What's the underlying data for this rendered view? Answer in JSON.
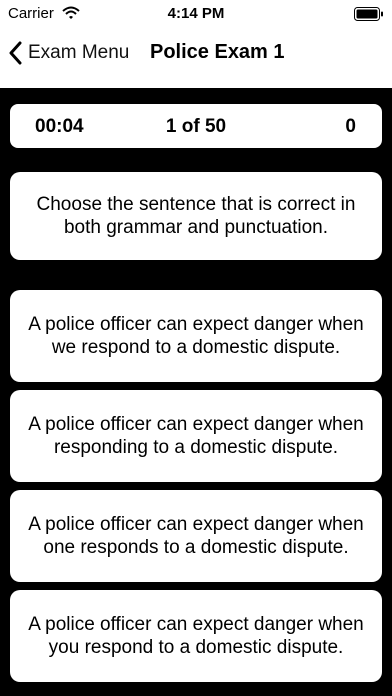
{
  "status_bar": {
    "carrier": "Carrier",
    "time": "4:14 PM",
    "wifi_icon": "wifi-icon",
    "battery_icon": "battery-icon"
  },
  "nav": {
    "back_label": "Exam Menu",
    "title": "Police Exam 1",
    "back_icon": "chevron-left-icon"
  },
  "stats": {
    "timer": "00:04",
    "progress": "1 of 50",
    "score": "0"
  },
  "question": {
    "text": "Choose the sentence that is correct in both grammar and punctuation."
  },
  "options": [
    "A police officer can expect danger when we respond to a domestic dispute.",
    "A police officer can expect danger when responding to a domestic dispute.",
    "A police officer can expect danger when one responds to a domestic dispute.",
    "A police officer can expect danger when you respond to a domestic dispute."
  ],
  "colors": {
    "background": "#000000",
    "card": "#ffffff",
    "text": "#000000"
  }
}
